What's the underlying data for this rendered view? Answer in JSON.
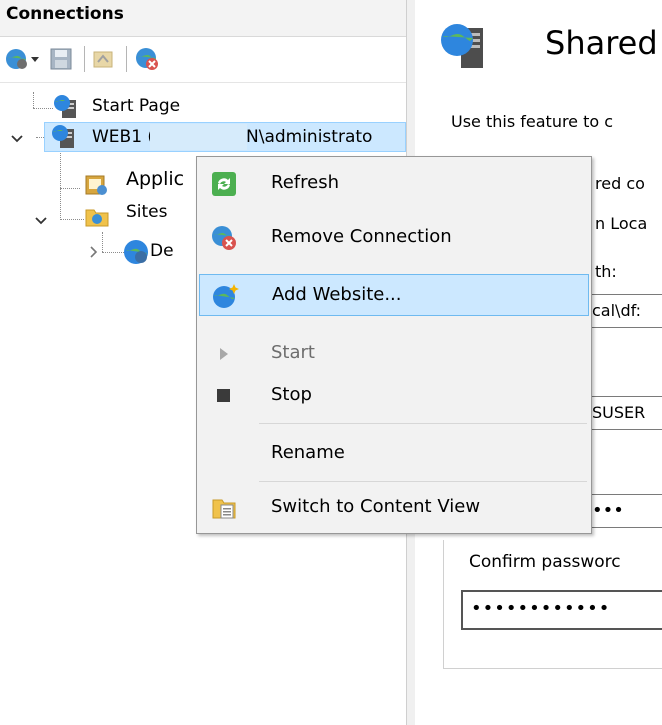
{
  "connections": {
    "title": "Connections",
    "toolbar": {
      "icons": [
        "connect-icon",
        "dropdown-arrow-icon",
        "save-icon",
        "up-icon",
        "disconnect-icon"
      ]
    },
    "tree": {
      "start_page": "Start Page",
      "server_prefix": "WEB1 (",
      "server_suffix": "N\\administrato",
      "app_pools": "Applic",
      "sites": "Sites",
      "default_site": "De"
    }
  },
  "context_menu": {
    "items": [
      {
        "label": "Refresh",
        "icon": "refresh-icon"
      },
      {
        "label": "Remove Connection",
        "icon": "remove-connection-icon"
      },
      {
        "label": "Add Website...",
        "icon": "add-website-icon",
        "highlighted": true
      },
      {
        "label": "Start",
        "icon": "start-icon",
        "disabled": true
      },
      {
        "label": "Stop",
        "icon": "stop-icon"
      },
      {
        "label": "Rename",
        "icon": ""
      },
      {
        "label": "Switch to Content View",
        "icon": "content-view-icon"
      }
    ]
  },
  "right_pane": {
    "title": "Shared",
    "description": "Use this feature to c",
    "fragments": {
      "line1": "red co",
      "line2": "n Loca",
      "line3": "th:",
      "path_value": "cal\\df:",
      "user_value": "SUSER",
      "password_dots": "•••"
    },
    "confirm_label": "Confirm passworc",
    "confirm_value": "••••••••••••"
  },
  "colors": {
    "selection": "#cce8ff",
    "menu_highlight_border": "#6fbaf0",
    "menu_bg": "#f2f2f2"
  }
}
